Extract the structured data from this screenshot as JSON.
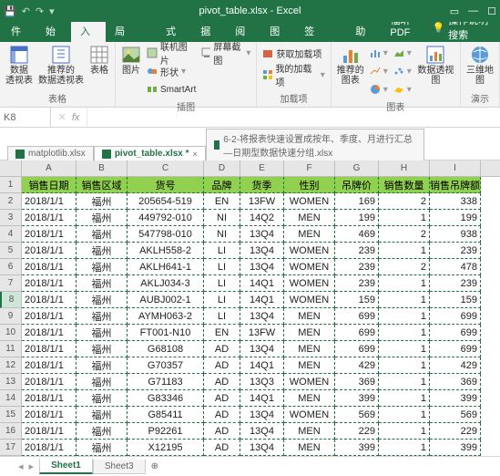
{
  "titlebar": {
    "title": "pivot_table.xlsx - Excel"
  },
  "tabs": {
    "file": "文件",
    "home": "开始",
    "insert": "插入",
    "layout": "页面布局",
    "formulas": "公式",
    "data": "数据",
    "review": "审阅",
    "view": "视图",
    "office": "办公标签",
    "help": "帮助",
    "foxit": "福昕PDF",
    "tell_me": "操作说明搜索"
  },
  "ribbon": {
    "tables": {
      "pivot_table": "数据\n透视表",
      "rec_pivot": "推荐的\n数据透视表",
      "table": "表格",
      "group": "表格"
    },
    "illus": {
      "pic": "图片",
      "online": "联机图片",
      "shapes": "形状",
      "smartart": "SmartArt",
      "screenshot": "屏幕截图",
      "group": "插图"
    },
    "addins": {
      "get": "获取加载项",
      "my": "我的加载项",
      "group": "加载项"
    },
    "charts": {
      "rec": "推荐的\n图表",
      "pivotchart": "数据透视图",
      "map3d": "三维地\n图",
      "group": "图表",
      "tour": "演示"
    }
  },
  "namebox": "K8",
  "wbtabs": {
    "t1": "matplotlib.xlsx",
    "t2": "pivot_table.xlsx *",
    "t3": "6-2-将报表快速设置成按年、季度、月进行汇总—日期型数据快速分组.xlsx"
  },
  "headers": [
    "销售日期",
    "销售区域",
    "货号",
    "品牌",
    "货季",
    "性别",
    "吊牌价",
    "销售数量",
    "销售吊牌额"
  ],
  "rows": [
    [
      "2018/1/1",
      "福州",
      "205654-519",
      "EN",
      "13FW",
      "WOMEN",
      "169",
      "2",
      "338"
    ],
    [
      "2018/1/1",
      "福州",
      "449792-010",
      "NI",
      "14Q2",
      "MEN",
      "199",
      "1",
      "199"
    ],
    [
      "2018/1/1",
      "福州",
      "547798-010",
      "NI",
      "13Q4",
      "MEN",
      "469",
      "2",
      "938"
    ],
    [
      "2018/1/1",
      "福州",
      "AKLH558-2",
      "LI",
      "13Q4",
      "WOMEN",
      "239",
      "1",
      "239"
    ],
    [
      "2018/1/1",
      "福州",
      "AKLH641-1",
      "LI",
      "13Q4",
      "WOMEN",
      "239",
      "2",
      "478"
    ],
    [
      "2018/1/1",
      "福州",
      "AKLJ034-3",
      "LI",
      "14Q1",
      "WOMEN",
      "239",
      "1",
      "239"
    ],
    [
      "2018/1/1",
      "福州",
      "AUBJ002-1",
      "LI",
      "14Q1",
      "WOMEN",
      "159",
      "1",
      "159"
    ],
    [
      "2018/1/1",
      "福州",
      "AYMH063-2",
      "LI",
      "13Q4",
      "MEN",
      "699",
      "1",
      "699"
    ],
    [
      "2018/1/1",
      "福州",
      "FT001-N10",
      "EN",
      "13FW",
      "MEN",
      "699",
      "1",
      "699"
    ],
    [
      "2018/1/1",
      "福州",
      "G68108",
      "AD",
      "13Q4",
      "MEN",
      "699",
      "1",
      "699"
    ],
    [
      "2018/1/1",
      "福州",
      "G70357",
      "AD",
      "14Q1",
      "MEN",
      "429",
      "1",
      "429"
    ],
    [
      "2018/1/1",
      "福州",
      "G71183",
      "AD",
      "13Q3",
      "WOMEN",
      "369",
      "1",
      "369"
    ],
    [
      "2018/1/1",
      "福州",
      "G83346",
      "AD",
      "14Q1",
      "MEN",
      "399",
      "1",
      "399"
    ],
    [
      "2018/1/1",
      "福州",
      "G85411",
      "AD",
      "13Q4",
      "WOMEN",
      "569",
      "1",
      "569"
    ],
    [
      "2018/1/1",
      "福州",
      "P92261",
      "AD",
      "13Q4",
      "MEN",
      "229",
      "1",
      "229"
    ],
    [
      "2018/1/1",
      "福州",
      "X12195",
      "AD",
      "13Q4",
      "MEN",
      "399",
      "1",
      "399"
    ]
  ],
  "sheet_tabs": {
    "s1": "Sheet1",
    "s3": "Sheet3"
  }
}
